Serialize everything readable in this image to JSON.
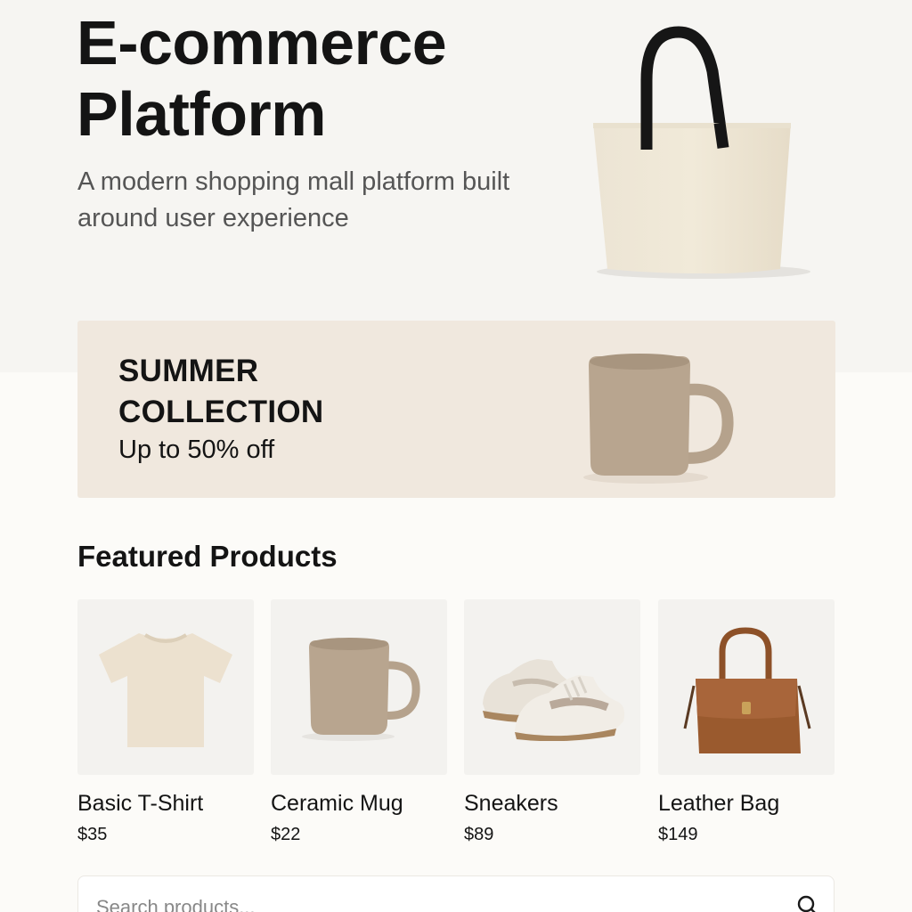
{
  "hero": {
    "title": "E-commerce\nPlatform",
    "subtitle": "A modern shopping mall platform built around user experience",
    "image_icon": "tote-bag"
  },
  "promo": {
    "title": "SUMMER\nCOLLECTION",
    "subtitle": "Up to 50% off",
    "image_icon": "mug"
  },
  "featured": {
    "title": "Featured Products",
    "products": [
      {
        "name": "Basic T-Shirt",
        "price": "$35",
        "icon": "t-shirt"
      },
      {
        "name": "Ceramic Mug",
        "price": "$22",
        "icon": "mug"
      },
      {
        "name": "Sneakers",
        "price": "$89",
        "icon": "sneakers"
      },
      {
        "name": "Leather Bag",
        "price": "$149",
        "icon": "handbag"
      }
    ]
  },
  "search": {
    "placeholder": "Search products...",
    "value": "",
    "icon": "search-icon"
  },
  "colors": {
    "hero_bg": "#f6f5f2",
    "promo_bg": "#f0e8de",
    "tile_bg": "#f3f2ef",
    "mug_tan": "#b5a28c",
    "leather_brown": "#9a5a2e"
  }
}
